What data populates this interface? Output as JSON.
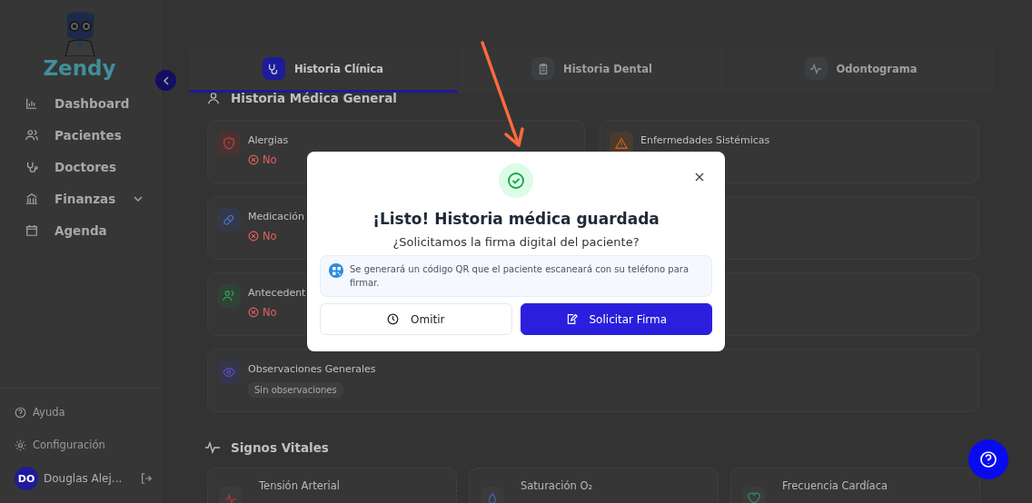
{
  "sidebar": {
    "logo": "Zendy",
    "nav": [
      {
        "label": "Dashboard",
        "selected": false,
        "expandable": false
      },
      {
        "label": "Pacientes",
        "selected": false,
        "expandable": false
      },
      {
        "label": "Doctores",
        "selected": false,
        "expandable": false
      },
      {
        "label": "Finanzas",
        "selected": false,
        "expandable": true
      },
      {
        "label": "Agenda",
        "selected": false,
        "expandable": false
      }
    ],
    "footer": [
      {
        "label": "Ayuda"
      },
      {
        "label": "Configuración"
      }
    ],
    "user": {
      "initials": "DO",
      "name": "Douglas Alej..."
    }
  },
  "tabs": [
    {
      "label": "Historia Clínica",
      "selected": true
    },
    {
      "label": "Historia Dental",
      "selected": false
    },
    {
      "label": "Odontograma",
      "selected": false
    }
  ],
  "medical_history": {
    "title": "Historia Médica General",
    "left": [
      {
        "title": "Alergias",
        "value": "No",
        "negative": true
      },
      {
        "title": "Medicación",
        "value": "No",
        "negative": true
      },
      {
        "title": "Antecedent",
        "value": "No",
        "negative": true
      }
    ],
    "right": [
      {
        "title": "Enfermedades Sistémicas"
      }
    ],
    "observations": {
      "title": "Observaciones Generales",
      "badge": "Sin observaciones"
    }
  },
  "vitals": {
    "title": "Signos Vitales",
    "items": [
      {
        "label": "Tensión Arterial"
      },
      {
        "label": "Saturación O₂"
      },
      {
        "label": "Frecuencia Cardíaca"
      }
    ]
  },
  "modal": {
    "title": "¡Listo! Historia médica guardada",
    "question": "¿Solicitamos la firma digital del paciente?",
    "info": "Se generará un código QR que el paciente escaneará con su teléfono para firmar.",
    "buttons": [
      {
        "label": "Omitir",
        "kind": "secondary"
      },
      {
        "label": "Solicitar Firma",
        "kind": "primary"
      }
    ]
  }
}
